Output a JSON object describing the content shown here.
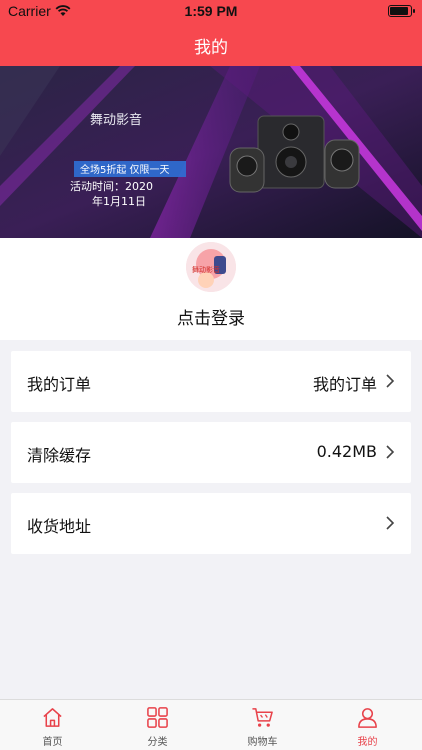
{
  "status_bar": {
    "carrier": "Carrier",
    "time": "1:59 PM"
  },
  "nav": {
    "title": "我的"
  },
  "banner": {
    "brand": "舞动影音",
    "promo": "全场5折起  仅限一天",
    "event_line1": "活动时间：2020",
    "event_line2": "年1月11日"
  },
  "profile": {
    "avatar_text": "舞动影音",
    "login_label": "点击登录"
  },
  "rows": [
    {
      "label": "我的订单",
      "value": "我的订单"
    },
    {
      "label": "清除缓存",
      "value": "0.42MB"
    },
    {
      "label": "收货地址",
      "value": ""
    }
  ],
  "tabs": [
    {
      "label": "首页",
      "icon": "home-icon"
    },
    {
      "label": "分类",
      "icon": "grid-icon"
    },
    {
      "label": "购物车",
      "icon": "cart-icon"
    },
    {
      "label": "我的",
      "icon": "person-icon"
    }
  ],
  "colors": {
    "accent": "#f7484f",
    "tab_active": "#e8424a",
    "background": "#f2f2f6"
  }
}
